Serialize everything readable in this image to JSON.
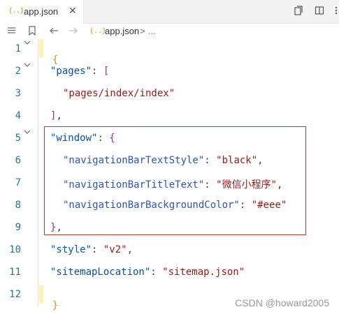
{
  "tab": {
    "icon": "{..}",
    "title": "app.json",
    "close": "✕"
  },
  "toolbar": {
    "right_icons": [
      "open-preview-icon",
      "split-editor-icon",
      "more-actions-icon"
    ]
  },
  "breadcrumb": {
    "file_icon": "{..}",
    "file": "app.json",
    "sep": ">",
    "more": "..."
  },
  "lines": [
    {
      "num": "1",
      "text": "{"
    },
    {
      "num": "2",
      "text": "\"pages\": ["
    },
    {
      "num": "3",
      "text": "\"pages/index/index\""
    },
    {
      "num": "4",
      "text": "],"
    },
    {
      "num": "5",
      "text": "\"window\": {"
    },
    {
      "num": "6",
      "text": "\"navigationBarTextStyle\": \"black\","
    },
    {
      "num": "7",
      "text": "\"navigationBarTitleText\": \"微信小程序\","
    },
    {
      "num": "8",
      "text": "\"navigationBarBackgroundColor\": \"#eee\""
    },
    {
      "num": "9",
      "text": "},"
    },
    {
      "num": "10",
      "text": "\"style\": \"v2\","
    },
    {
      "num": "11",
      "text": "\"sitemapLocation\": \"sitemap.json\""
    },
    {
      "num": "12",
      "text": "}"
    }
  ],
  "code": {
    "l1_brace": "{",
    "l2_key": "\"pages\"",
    "l2_colon": ": ",
    "l2_bracket": "[",
    "l3_str": "\"pages/index/index\"",
    "l4_bracket": "]",
    "l4_comma": ",",
    "l5_key": "\"window\"",
    "l5_colon": ": ",
    "l5_brace": "{",
    "l6_key": "\"navigationBarTextStyle\"",
    "l6_colon": ": ",
    "l6_val": "\"black\"",
    "l6_comma": ",",
    "l7_key": "\"navigationBarTitleText\"",
    "l7_colon": ": ",
    "l7_val": "\"微信小程序\"",
    "l7_comma": ",",
    "l8_key": "\"navigationBarBackgroundColor\"",
    "l8_colon": ": ",
    "l8_val": "\"#eee\"",
    "l9_brace": "}",
    "l9_comma": ",",
    "l10_key": "\"style\"",
    "l10_colon": ": ",
    "l10_val": "\"v2\"",
    "l10_comma": ",",
    "l11_key": "\"sitemapLocation\"",
    "l11_colon": ": ",
    "l11_val": "\"sitemap.json\"",
    "l12_brace": "}"
  },
  "watermark": "CSDN @howard2005",
  "colors": {
    "brace": "#c79a00",
    "bracket": "#a626a4",
    "key": "#2a55b3",
    "string": "#a31515",
    "line_number": "#237893",
    "highlight_box": "#c0392b"
  }
}
